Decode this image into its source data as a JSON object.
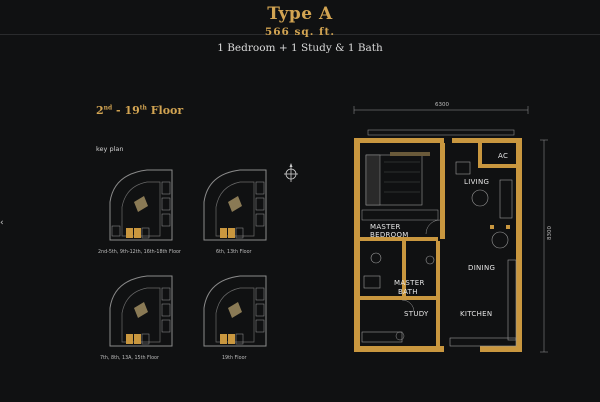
{
  "title": "Type A",
  "area": "566 sq. ft.",
  "configuration": "1 Bedroom + 1 Study & 1 Bath",
  "floor_range": {
    "first": "2",
    "first_sup": "nd",
    "sep": " - ",
    "last": "19",
    "last_sup": "th",
    "word": " Floor"
  },
  "key_plan_label": "key plan",
  "key_plans": [
    {
      "caption": "2nd-5th, 9th-12th, 16th-18th Floor"
    },
    {
      "caption": "6th, 13th Floor"
    },
    {
      "caption": "7th, 8th, 13A, 15th Floor"
    },
    {
      "caption": "19th Floor"
    }
  ],
  "rooms": {
    "master_bedroom": "MASTER BEDROOM",
    "living": "LIVING",
    "ac": "AC",
    "dining": "DINING",
    "master_bath_1": "MASTER",
    "master_bath_2": "BATH",
    "study": "STUDY",
    "kitchen": "KITCHEN"
  },
  "dimensions": {
    "width": "6300",
    "depth": "8300"
  },
  "side_mark": "‹",
  "colors": {
    "background": "#101112",
    "gold": "#d2a452",
    "wall": "#c9973f"
  }
}
